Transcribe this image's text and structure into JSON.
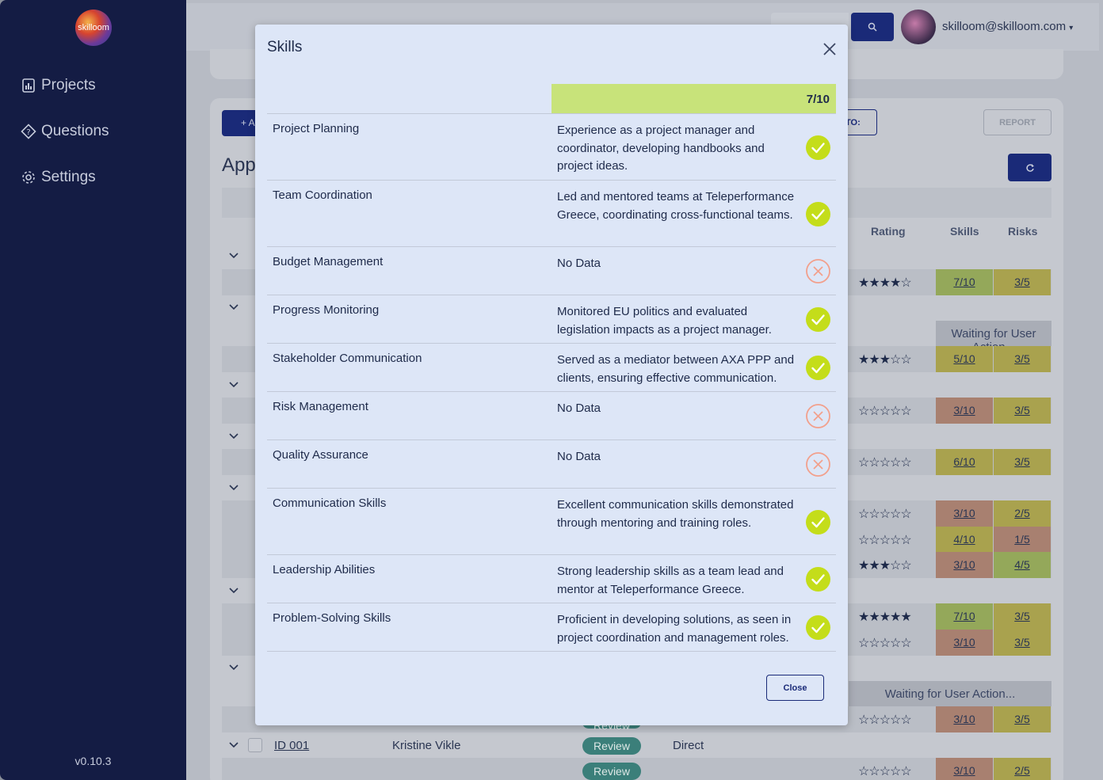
{
  "app": {
    "logo_text": "skilloom",
    "version": "v0.10.3",
    "user_email": "skilloom@skilloom.com"
  },
  "sidebar": {
    "items": [
      {
        "label": "Projects",
        "icon": "bar-chart-icon"
      },
      {
        "label": "Questions",
        "icon": "question-diamond-icon"
      },
      {
        "label": "Settings",
        "icon": "gear-icon"
      }
    ]
  },
  "background": {
    "add_button": "+ A",
    "title": "App",
    "to_button": "TO:",
    "report_button": "REPORT",
    "columns": {
      "rating": "Rating",
      "skills": "Skills",
      "risks": "Risks"
    },
    "waiting_text": "Waiting for User Action...",
    "rows": [
      {
        "stars": "★★★★☆",
        "skills": "7/10",
        "risks": "3/5"
      },
      {
        "stars": "★★★☆☆",
        "skills": "5/10",
        "risks": "3/5"
      },
      {
        "stars": "☆☆☆☆☆",
        "skills": "3/10",
        "risks": "3/5"
      },
      {
        "stars": "☆☆☆☆☆",
        "skills": "6/10",
        "risks": "3/5"
      },
      {
        "stars": "☆☆☆☆☆",
        "skills": "3/10",
        "risks": "2/5"
      },
      {
        "stars": "☆☆☆☆☆",
        "skills": "4/10",
        "risks": "1/5"
      },
      {
        "stars": "★★★☆☆",
        "skills": "3/10",
        "risks": "4/5"
      },
      {
        "stars": "★★★★★",
        "skills": "7/10",
        "risks": "3/5"
      },
      {
        "stars": "☆☆☆☆☆",
        "skills": "3/10",
        "risks": "3/5"
      },
      {
        "stars": "☆☆☆☆☆",
        "skills": "3/10",
        "risks": "3/5"
      },
      {
        "stars": "☆☆☆☆☆",
        "skills": "3/10",
        "risks": "2/5"
      }
    ],
    "last_row": {
      "id": "ID 001",
      "name": "Kristine Vikle",
      "status": "Review",
      "type": "Direct"
    },
    "review_label": "Review"
  },
  "modal": {
    "title": "Skills",
    "score": "7/10",
    "close_button": "Close",
    "skills": [
      {
        "name": "Project Planning",
        "desc": "Experience as a project manager and coordinator, developing handbooks and project ideas.",
        "status": "ok"
      },
      {
        "name": "Team Coordination",
        "desc": "Led and mentored teams at Teleperformance Greece, coordinating cross-functional teams.",
        "status": "ok"
      },
      {
        "name": "Budget Management",
        "desc": "No Data",
        "status": "missing"
      },
      {
        "name": "Progress Monitoring",
        "desc": "Monitored EU politics and evaluated legislation impacts as a project manager.",
        "status": "ok"
      },
      {
        "name": "Stakeholder Communication",
        "desc": "Served as a mediator between AXA PPP and clients, ensuring effective communication.",
        "status": "ok"
      },
      {
        "name": "Risk Management",
        "desc": "No Data",
        "status": "missing"
      },
      {
        "name": "Quality Assurance",
        "desc": "No Data",
        "status": "missing"
      },
      {
        "name": "Communication Skills",
        "desc": "Excellent communication skills demonstrated through mentoring and training roles.",
        "status": "ok"
      },
      {
        "name": "Leadership Abilities",
        "desc": "Strong leadership skills as a team lead and mentor at Teleperformance Greece.",
        "status": "ok"
      },
      {
        "name": "Problem-Solving Skills",
        "desc": "Proficient in developing solutions, as seen in project coordination and management roles.",
        "status": "ok"
      }
    ]
  },
  "colors": {
    "sidebar_bg": "#141c44",
    "accent": "#1a2a78",
    "score_band": "#c8e37a",
    "check_green": "#c4dd1a",
    "missing_red": "#f2a08c"
  }
}
